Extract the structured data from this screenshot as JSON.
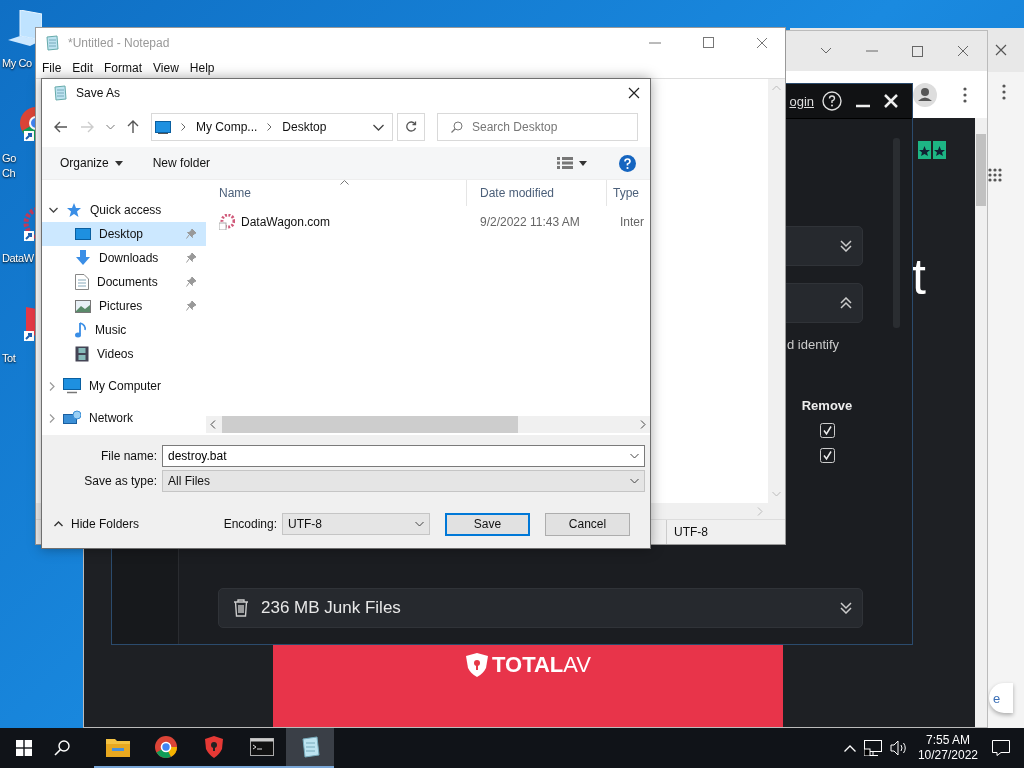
{
  "desktop_icons": [
    {
      "kind": "computer",
      "lines": [
        "My Co"
      ]
    },
    {
      "kind": "chrome",
      "lines": [
        "Go",
        "Ch"
      ]
    },
    {
      "kind": "datawagon",
      "lines": [
        "DataW"
      ]
    },
    {
      "kind": "totalav",
      "lines": [
        "Tot"
      ]
    }
  ],
  "browser": {
    "page": {
      "heading_fragment": "t",
      "banner": {
        "brand": "TOTAL",
        "brand_suffix": "AV"
      },
      "chat_fragment": "e"
    }
  },
  "totalav_window": {
    "login_link": "ogin",
    "accordions": [
      {
        "expanded": false
      },
      {
        "expanded": true
      }
    ],
    "text_fragment": "d identify",
    "column_heading": "Remove",
    "checkboxes": [
      {
        "checked": true
      },
      {
        "checked": true
      }
    ],
    "junk_card": {
      "label": "236 MB Junk Files",
      "expanded": false
    }
  },
  "notepad": {
    "title": "*Untitled - Notepad",
    "menu": [
      "File",
      "Edit",
      "Format",
      "View",
      "Help"
    ],
    "status_encoding": "UTF-8"
  },
  "save_dialog": {
    "title": "Save As",
    "breadcrumb": [
      "My Comp...",
      "Desktop"
    ],
    "search": {
      "placeholder": "Search Desktop"
    },
    "toolbar": [
      "Organize",
      "New folder"
    ],
    "nav_tree": [
      {
        "label": "Quick access",
        "kind": "star",
        "expanded": true,
        "selected": false,
        "children": [
          {
            "label": "Desktop",
            "kind": "desktop",
            "pinned": true,
            "selected": true
          },
          {
            "label": "Downloads",
            "kind": "download",
            "pinned": true,
            "selected": false
          },
          {
            "label": "Documents",
            "kind": "document",
            "pinned": true,
            "selected": false
          },
          {
            "label": "Pictures",
            "kind": "picture",
            "pinned": true,
            "selected": false
          },
          {
            "label": "Music",
            "kind": "music",
            "pinned": false,
            "selected": false
          },
          {
            "label": "Videos",
            "kind": "video",
            "pinned": false,
            "selected": false
          }
        ]
      },
      {
        "label": "My Computer",
        "kind": "computer",
        "expanded": false,
        "selected": false
      },
      {
        "label": "Network",
        "kind": "network",
        "expanded": false,
        "selected": false
      }
    ],
    "columns": [
      "Name",
      "Date modified",
      "Type"
    ],
    "files": [
      {
        "name": "DataWagon.com",
        "date": "9/2/2022 11:43 AM",
        "type": "Inter"
      }
    ],
    "file_name_label": "File name:",
    "file_name": "destroy.bat",
    "type_label": "Save as type:",
    "save_as_type": "All Files",
    "hide_folders": "Hide Folders",
    "encoding_label": "Encoding:",
    "encoding": "UTF-8",
    "buttons": [
      "Save",
      "Cancel"
    ]
  },
  "taskbar": {
    "apps": [
      {
        "kind": "explorer",
        "running": true,
        "selected": false
      },
      {
        "kind": "chrome",
        "running": true,
        "selected": false
      },
      {
        "kind": "shield",
        "running": true,
        "selected": false
      },
      {
        "kind": "terminal",
        "running": true,
        "selected": false
      },
      {
        "kind": "notepad",
        "running": true,
        "selected": true
      }
    ],
    "time": "7:55 AM",
    "date": "10/27/2022"
  }
}
